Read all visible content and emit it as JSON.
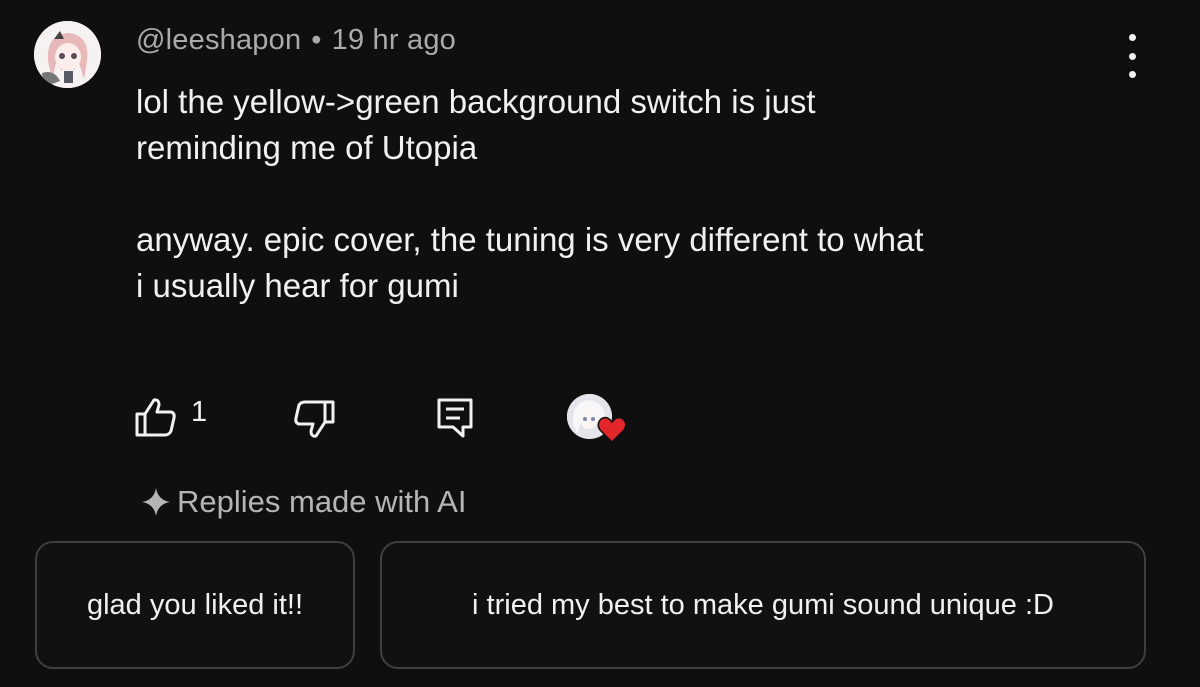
{
  "comment": {
    "author": "@leeshapon",
    "separator": "•",
    "time": "19 hr ago",
    "text": "lol the yellow->green background switch is just\nreminding me of Utopia\n\nanyway. epic cover, the tuning is very different to what\ni usually hear for gumi",
    "like_count": "1"
  },
  "icons": {
    "menu": "more-vert-icon",
    "like": "thumb-up-icon",
    "dislike": "thumb-down-icon",
    "reply": "reply-comment-icon",
    "creator_heart": "heart-icon",
    "ai": "sparkle-icon"
  },
  "ai_replies": {
    "label": "Replies made with AI",
    "suggestions": [
      "glad you liked it!!",
      "i tried my best to make gumi sound unique :D"
    ]
  },
  "colors": {
    "background": "#0f0f0f",
    "text": "#f1f1f1",
    "secondary": "#aaaaaa",
    "heart": "#e3262c",
    "chip_border": "#3f3f3f"
  }
}
